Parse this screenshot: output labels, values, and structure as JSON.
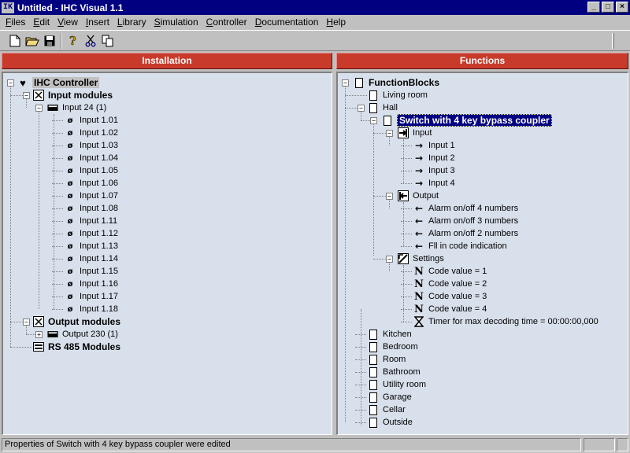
{
  "window": {
    "title": "Untitled - IHC Visual 1.1",
    "app_icon": "IK"
  },
  "menu": [
    {
      "label": "Files",
      "u": "F",
      "rest": "iles"
    },
    {
      "label": "Edit",
      "u": "E",
      "rest": "dit"
    },
    {
      "label": "View",
      "u": "V",
      "rest": "iew"
    },
    {
      "label": "Insert",
      "u": "I",
      "rest": "nsert"
    },
    {
      "label": "Library",
      "u": "L",
      "rest": "ibrary"
    },
    {
      "label": "Simulation",
      "u": "S",
      "rest": "imulation"
    },
    {
      "label": "Controller",
      "u": "C",
      "rest": "ontroller"
    },
    {
      "label": "Documentation",
      "u": "D",
      "rest": "ocumentation"
    },
    {
      "label": "Help",
      "u": "H",
      "rest": "elp"
    }
  ],
  "toolbar": {
    "icons": [
      "new-file-icon",
      "open-folder-icon",
      "save-disk-icon",
      "help-question-icon",
      "cut-scissors-icon",
      "copy-icon"
    ]
  },
  "installation": {
    "header": "Installation",
    "root": "IHC Controller",
    "input_modules": "Input modules",
    "input_group": "Input 24 (1)",
    "inputs": [
      "Input 1.01",
      "Input 1.02",
      "Input 1.03",
      "Input 1.04",
      "Input 1.05",
      "Input 1.06",
      "Input 1.07",
      "Input 1.08",
      "Input 1.11",
      "Input 1.12",
      "Input 1.13",
      "Input 1.14",
      "Input 1.15",
      "Input 1.16",
      "Input 1.17",
      "Input 1.18"
    ],
    "output_modules": "Output modules",
    "output_group": "Output 230 (1)",
    "rs485": "RS 485 Modules"
  },
  "functions": {
    "header": "Functions",
    "root": "FunctionBlocks",
    "living_room": "Living room",
    "hall": "Hall",
    "switch": "Switch with 4  key bypass coupler",
    "input": "Input",
    "inputs": [
      "Input 1",
      "Input 2",
      "Input 3",
      "Input 4"
    ],
    "output": "Output",
    "outputs": [
      "Alarm on/off 4 numbers",
      "Alarm on/off 3 numbers",
      "Alarm on/off 2 numbers",
      "Fll in code indication"
    ],
    "settings": "Settings",
    "settings_items": [
      "Code value = 1",
      "Code value = 2",
      "Code value = 3",
      "Code value = 4"
    ],
    "timer": "Timer for max decoding time = 00:00:00,000",
    "rooms": [
      "Kitchen",
      "Bedroom",
      "Room",
      "Bathroom",
      "Utility room",
      "Garage",
      "Cellar",
      "Outside"
    ]
  },
  "status": {
    "message": "Properties of Switch with 4  key bypass coupler were edited"
  },
  "colors": {
    "title_bar": "#000080",
    "panel_header": "#c83a2a",
    "tree_bg": "#d8e0ec",
    "selection": "#000080"
  }
}
